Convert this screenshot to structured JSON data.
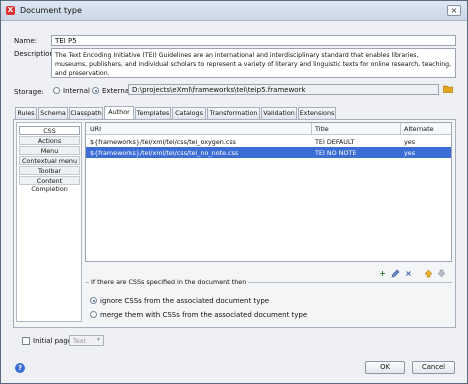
{
  "window": {
    "title": "Document type",
    "close_glyph": "×"
  },
  "form": {
    "name_label": "Name:",
    "name_value": "TEI P5",
    "description_label": "Description:",
    "description_value": "The Text Encoding Initiative (TEI) Guidelines are an international and interdisciplinary standard that enables libraries, museums, publishers, and individual scholars to represent a variety of literary and linguistic texts for online research, teaching, and preservation.",
    "storage_label": "Storage:",
    "storage_internal": "Internal",
    "storage_external": "External",
    "storage_selected": "External",
    "storage_path": "D:\\projects\\eXml\\frameworks\\tei\\teip5.framework"
  },
  "tabs": [
    "Rules",
    "Schema",
    "Classpath",
    "Author",
    "Templates",
    "Catalogs",
    "Transformation",
    "Validation",
    "Extensions"
  ],
  "active_tab": "Author",
  "sidebar": {
    "items": [
      "CSS",
      "Actions",
      "Menu",
      "Contextual menu",
      "Toolbar",
      "Content Completion"
    ],
    "active": "CSS"
  },
  "table": {
    "headers": [
      "URI",
      "Title",
      "Alternate"
    ],
    "rows": [
      {
        "uri": "${frameworks}/tei/xml/tei/css/tei_oxygen.css",
        "title": "TEI DEFAULT",
        "alternate": "yes"
      },
      {
        "uri": "${frameworks}/tei/xml/tei/css/tei_no_note.css",
        "title": "TEI NO NOTE",
        "alternate": "yes"
      }
    ],
    "selected_row": 1
  },
  "toolbar_icons": [
    "add-icon",
    "edit-icon",
    "remove-icon",
    "move-up-icon",
    "move-down-icon"
  ],
  "css_options": {
    "title": "If there are CSSs specified in the document then",
    "ignore": "ignore CSSs from the associated document type",
    "merge": "merge them with CSSs from the associated document type",
    "selected": "ignore"
  },
  "initial_page": {
    "label": "Initial page",
    "value": "Text",
    "checked": false
  },
  "buttons": {
    "ok": "OK",
    "cancel": "Cancel",
    "help": "?"
  }
}
